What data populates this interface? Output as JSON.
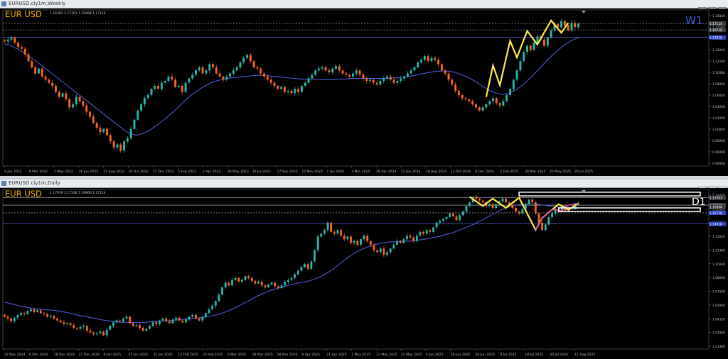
{
  "colors": {
    "background": "#000000",
    "bull": "#2ab3a6",
    "bear": "#f26522",
    "ma": "#4b5bd6",
    "zigzag_w1": "#ffe94d",
    "zigzag_d1": "#ffe94d",
    "zigzag_d1_b": "#d13f96",
    "label": "#f0b400",
    "timeframe_w1": "#3c5fd8",
    "timeframe_d1": "#ffffff",
    "axis_text": "#b7bcc4",
    "hline": "#a9afb6",
    "hline_blue": "#5566d6"
  },
  "top_window": {
    "title": "EURUSD.ciy1m,Weekly",
    "controls": [
      "–",
      "□",
      "×"
    ]
  },
  "bottom_window": {
    "title": "EURUSD.ciy1m,Daily",
    "controls": [
      "–",
      "□",
      "×"
    ]
  },
  "chart_data": [
    {
      "type": "candlestick",
      "symbol_label": "EUR USD",
      "timeframe": "W1",
      "ohlc_text": "1.16382 1.17301 1.15898 1.17114",
      "ylim": [
        0.94,
        1.193
      ],
      "y_ticks": [
        "1.18840",
        "1.17560",
        "1.16120",
        "1.14040",
        "1.12160",
        "1.10080",
        "1.08000",
        "1.06000",
        "1.04000",
        "1.02000",
        "1.00000",
        "0.98000",
        "0.96000",
        "0.94060"
      ],
      "price_badges": [
        {
          "text": "1.17114",
          "value": 1.1711,
          "style": "grey"
        },
        {
          "text": "1.16738",
          "value": 1.1606,
          "style": "grey"
        },
        {
          "text": "1.14836",
          "value": 1.1486,
          "style": "blue"
        }
      ],
      "hlines": [
        {
          "value": 1.1711,
          "style": "grey",
          "dash": true
        },
        {
          "value": 1.1606,
          "style": "grey",
          "dash": true
        },
        {
          "value": 1.1486,
          "style": "blue",
          "dash": false
        }
      ],
      "x_labels": [
        "9 Jan 2022",
        "6 Mar 2022",
        "1 May 2022",
        "26 Jun 2022",
        "21 Aug 2022",
        "16 Oct 2022",
        "11 Dec 2022",
        "5 Feb 2023",
        "2 Apr 2023",
        "28 May 2023",
        "23 Jul 2023",
        "17 Sep 2023",
        "12 Nov 2023",
        "7 Jan 2024",
        "3 Mar 2024",
        "28 Apr 2024",
        "23 Jun 2024",
        "18 Aug 2024",
        "13 Oct 2024",
        "8 Dec 2024",
        "2 Feb 2025",
        "30 Mar 2025",
        "25 May 2025",
        "20 Jul 2025"
      ],
      "closes": [
        1.142,
        1.145,
        1.148,
        1.14,
        1.133,
        1.13,
        1.121,
        1.11,
        1.1,
        1.09,
        1.098,
        1.085,
        1.08,
        1.075,
        1.07,
        1.06,
        1.052,
        1.058,
        1.048,
        1.035,
        1.04,
        1.052,
        1.045,
        1.038,
        1.028,
        1.02,
        1.01,
        1.002,
        0.995,
        1.0,
        0.99,
        0.98,
        0.97,
        0.975,
        0.965,
        0.98,
        0.985,
        1.0,
        1.015,
        1.03,
        1.04,
        1.05,
        1.055,
        1.065,
        1.07,
        1.065,
        1.075,
        1.078,
        1.085,
        1.08,
        1.068,
        1.07,
        1.06,
        1.075,
        1.082,
        1.088,
        1.095,
        1.1,
        1.09,
        1.095,
        1.105,
        1.1,
        1.09,
        1.085,
        1.08,
        1.085,
        1.09,
        1.095,
        1.1,
        1.108,
        1.115,
        1.12,
        1.11,
        1.1,
        1.098,
        1.09,
        1.085,
        1.08,
        1.075,
        1.07,
        1.065,
        1.068,
        1.06,
        1.062,
        1.058,
        1.065,
        1.06,
        1.07,
        1.075,
        1.082,
        1.088,
        1.095,
        1.098,
        1.1,
        1.095,
        1.092,
        1.098,
        1.102,
        1.095,
        1.09,
        1.088,
        1.085,
        1.09,
        1.095,
        1.088,
        1.082,
        1.078,
        1.08,
        1.075,
        1.072,
        1.078,
        1.082,
        1.085,
        1.08,
        1.075,
        1.078,
        1.082,
        1.085,
        1.09,
        1.095,
        1.1,
        1.108,
        1.112,
        1.118,
        1.11,
        1.115,
        1.112,
        1.105,
        1.095,
        1.09,
        1.08,
        1.072,
        1.062,
        1.055,
        1.05,
        1.048,
        1.045,
        1.04,
        1.035,
        1.03,
        1.035,
        1.04,
        1.045,
        1.05,
        1.042,
        1.038,
        1.045,
        1.055,
        1.065,
        1.08,
        1.095,
        1.11,
        1.125,
        1.135,
        1.128,
        1.14,
        1.15,
        1.145,
        1.135,
        1.148,
        1.16,
        1.17,
        1.165,
        1.175,
        1.168,
        1.16,
        1.172,
        1.165,
        1.171
      ],
      "ma_values": [
        1.138,
        1.135,
        1.13,
        1.124,
        1.117,
        1.11,
        1.102,
        1.094,
        1.086,
        1.078,
        1.07,
        1.062,
        1.054,
        1.046,
        1.038,
        1.03,
        1.022,
        1.014,
        1.006,
        0.998,
        0.992,
        0.99,
        0.993,
        0.998,
        1.005,
        1.013,
        1.021,
        1.03,
        1.04,
        1.05,
        1.058,
        1.065,
        1.071,
        1.076,
        1.079,
        1.081,
        1.083,
        1.084,
        1.085,
        1.086,
        1.087,
        1.087,
        1.086,
        1.085,
        1.084,
        1.083,
        1.082,
        1.081,
        1.081,
        1.081,
        1.08,
        1.08,
        1.08,
        1.081,
        1.081,
        1.082,
        1.082,
        1.082,
        1.082,
        1.082,
        1.082,
        1.082,
        1.083,
        1.084,
        1.085,
        1.087,
        1.089,
        1.091,
        1.093,
        1.094,
        1.094,
        1.093,
        1.09,
        1.086,
        1.081,
        1.075,
        1.068,
        1.062,
        1.058,
        1.056,
        1.058,
        1.063,
        1.07,
        1.079,
        1.089,
        1.1,
        1.111,
        1.121,
        1.13,
        1.138,
        1.144,
        1.148
      ],
      "zigzag": [
        [
          141,
          1.052
        ],
        [
          143,
          1.103
        ],
        [
          145,
          1.071
        ],
        [
          148,
          1.143
        ],
        [
          150,
          1.116
        ],
        [
          153,
          1.159
        ],
        [
          156,
          1.137
        ],
        [
          160,
          1.176
        ],
        [
          163,
          1.156
        ],
        [
          165,
          1.172
        ]
      ]
    },
    {
      "type": "candlestick",
      "symbol_label": "EUR USD",
      "timeframe": "D1",
      "ohlc_text": "1.17039 1.17148 1.16866 1.17114",
      "ylim": [
        1.013,
        1.186
      ],
      "y_ticks": [
        "1.18040",
        "1.16320",
        "1.14600",
        "1.12820",
        "1.11480",
        "1.10040",
        "1.08600",
        "1.07200",
        "1.05800",
        "1.04320",
        "1.02900",
        "1.01480"
      ],
      "price_badges": [
        {
          "text": "1.17703",
          "value": 1.177,
          "style": "grey"
        },
        {
          "text": "1.16899",
          "value": 1.169,
          "style": "grey"
        },
        {
          "text": "1.16694",
          "value": 1.1669,
          "style": "grey"
        },
        {
          "text": "1.16738",
          "value": 1.1606,
          "style": "blue"
        },
        {
          "text": "1.14838",
          "value": 1.1486,
          "style": "blue"
        }
      ],
      "hlines": [
        {
          "value": 1.177,
          "style": "grey",
          "dash": false
        },
        {
          "value": 1.169,
          "style": "grey",
          "dash": false
        },
        {
          "value": 1.1606,
          "style": "grey",
          "dash": true
        },
        {
          "value": 1.1486,
          "style": "blue",
          "dash": false
        }
      ],
      "x_labels": [
        "22 Nov 2024",
        "6 Dec 2024",
        "18 Dec 2024",
        "27 Dec 2024",
        "9 Jan 2025",
        "21 Jan 2025",
        "31 Jan 2025",
        "12 Feb 2025",
        "24 Feb 2025",
        "6 Mar 2025",
        "18 Mar 2025",
        "28 Mar 2025",
        "9 Apr 2025",
        "21 Apr 2025",
        "1 May 2025",
        "12 May 2025",
        "22 May 2025",
        "4 Jun 2025",
        "16 Jun 2025",
        "26 Jun 2025",
        "8 Jul 2025",
        "18 Jul 2025",
        "30 Jul 2025",
        "11 Aug 2025"
      ],
      "closes": [
        1.048,
        1.046,
        1.043,
        1.047,
        1.05,
        1.052,
        1.051,
        1.054,
        1.056,
        1.053,
        1.055,
        1.052,
        1.051,
        1.048,
        1.049,
        1.046,
        1.044,
        1.042,
        1.04,
        1.041,
        1.039,
        1.036,
        1.035,
        1.037,
        1.038,
        1.033,
        1.031,
        1.029,
        1.03,
        1.032,
        1.028,
        1.034,
        1.038,
        1.042,
        1.044,
        1.043,
        1.046,
        1.048,
        1.041,
        1.038,
        1.039,
        1.036,
        1.033,
        1.035,
        1.038,
        1.042,
        1.04,
        1.044,
        1.046,
        1.043,
        1.041,
        1.045,
        1.047,
        1.044,
        1.042,
        1.045,
        1.048,
        1.05,
        1.046,
        1.044,
        1.048,
        1.052,
        1.056,
        1.06,
        1.065,
        1.072,
        1.08,
        1.085,
        1.082,
        1.088,
        1.09,
        1.086,
        1.088,
        1.092,
        1.09,
        1.087,
        1.084,
        1.086,
        1.082,
        1.08,
        1.083,
        1.085,
        1.081,
        1.079,
        1.082,
        1.086,
        1.088,
        1.09,
        1.094,
        1.098,
        1.102,
        1.105,
        1.1,
        1.108,
        1.12,
        1.135,
        1.138,
        1.142,
        1.15,
        1.14,
        1.138,
        1.142,
        1.136,
        1.132,
        1.135,
        1.128,
        1.13,
        1.126,
        1.132,
        1.136,
        1.13,
        1.126,
        1.12,
        1.118,
        1.122,
        1.115,
        1.118,
        1.122,
        1.126,
        1.13,
        1.128,
        1.132,
        1.136,
        1.134,
        1.13,
        1.136,
        1.14,
        1.138,
        1.142,
        1.14,
        1.145,
        1.15,
        1.152,
        1.154,
        1.156,
        1.16,
        1.157,
        1.153,
        1.158,
        1.162,
        1.168,
        1.172,
        1.178,
        1.176,
        1.174,
        1.172,
        1.168,
        1.17,
        1.166,
        1.17,
        1.173,
        1.176,
        1.172,
        1.169,
        1.166,
        1.162,
        1.16,
        1.165,
        1.17,
        1.175,
        1.172,
        1.16,
        1.15,
        1.142,
        1.148,
        1.156,
        1.16,
        1.165,
        1.162,
        1.168,
        1.163,
        1.166,
        1.165,
        1.17,
        1.1711
      ],
      "ma_values": [
        1.064,
        1.062,
        1.06,
        1.0585,
        1.057,
        1.056,
        1.0555,
        1.055,
        1.054,
        1.0525,
        1.0505,
        1.049,
        1.0475,
        1.046,
        1.0445,
        1.0435,
        1.0425,
        1.042,
        1.0418,
        1.0418,
        1.042,
        1.0425,
        1.043,
        1.0436,
        1.0442,
        1.0448,
        1.0455,
        1.0462,
        1.047,
        1.048,
        1.0495,
        1.0515,
        1.0545,
        1.058,
        1.062,
        1.066,
        1.07,
        1.0735,
        1.0765,
        1.079,
        1.081,
        1.083,
        1.0845,
        1.086,
        1.088,
        1.091,
        1.095,
        1.1,
        1.106,
        1.112,
        1.117,
        1.121,
        1.124,
        1.1265,
        1.128,
        1.129,
        1.1295,
        1.13,
        1.13,
        1.131,
        1.132,
        1.1335,
        1.135,
        1.137,
        1.139,
        1.142,
        1.145,
        1.148,
        1.152,
        1.156,
        1.16,
        1.164,
        1.167,
        1.169,
        1.17,
        1.1705,
        1.17,
        1.169,
        1.168,
        1.167,
        1.166,
        1.1655,
        1.165
      ],
      "zigzag": [
        [
          141,
          1.178
        ],
        [
          145,
          1.168
        ],
        [
          148,
          1.176
        ],
        [
          152,
          1.166
        ],
        [
          156,
          1.177
        ],
        [
          161,
          1.142
        ],
        [
          163,
          1.155
        ],
        [
          168,
          1.17
        ],
        [
          171,
          1.164
        ],
        [
          174,
          1.1711
        ]
      ],
      "zigzag_b": [
        [
          161,
          1.142
        ],
        [
          163,
          1.155
        ],
        [
          166,
          1.164
        ],
        [
          169,
          1.163
        ],
        [
          171,
          1.169
        ],
        [
          174,
          1.1711
        ]
      ],
      "boxes": [
        {
          "from": 156,
          "to": 1.0,
          "top": 1.183,
          "bottom": 1.179
        },
        {
          "from": 168,
          "to": 1.0,
          "top": 1.166,
          "bottom": 1.162
        }
      ]
    }
  ]
}
